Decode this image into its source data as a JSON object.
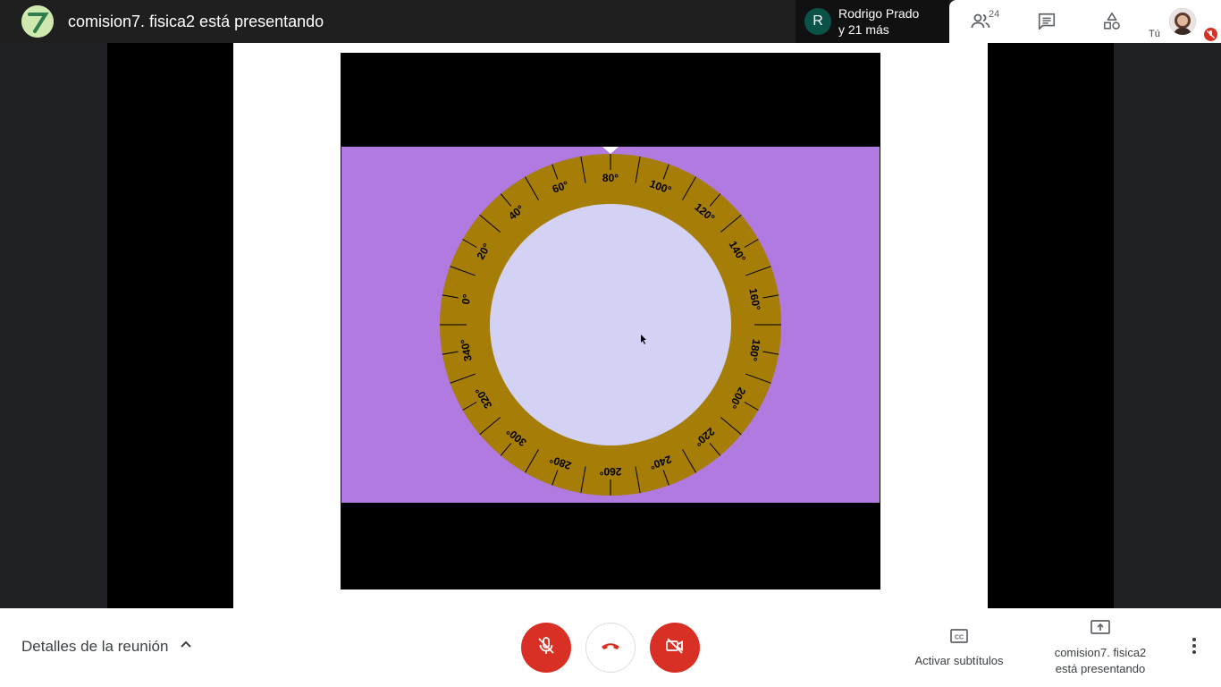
{
  "header": {
    "title": "comision7. fisica2 está presentando",
    "presenter_initial": "R",
    "presenter_line1": "Rodrigo Prado",
    "presenter_line2": "y 21 más",
    "participants_count": "24",
    "you_label": "Tú",
    "icons": [
      "people-icon",
      "chat-icon",
      "activities-icon"
    ]
  },
  "protractor": {
    "labels": [
      "0°",
      "20°",
      "40°",
      "60°",
      "80°",
      "100°",
      "120°",
      "140°",
      "160°",
      "180°",
      "200°",
      "220°",
      "240°",
      "260°",
      "280°",
      "300°",
      "320°",
      "340°"
    ]
  },
  "footer": {
    "details_label": "Detalles de la reunión",
    "captions_label": "Activar subtítulos",
    "presenting_line1": "comision7. fisica2",
    "presenting_line2": "está presentando"
  },
  "colors": {
    "ring": "#a57d07",
    "inner": "#d3d2f4",
    "background": "#b07ae0",
    "end_call": "#d93025"
  }
}
